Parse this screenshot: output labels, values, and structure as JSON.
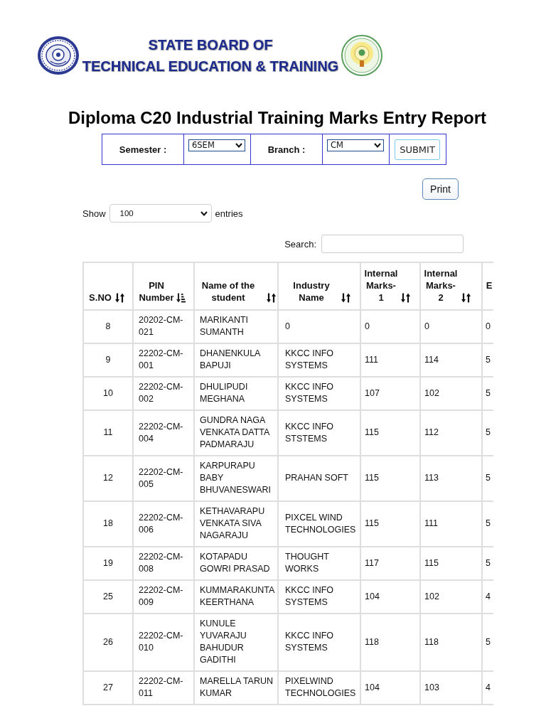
{
  "banner": {
    "line_1": "STATE BOARD OF",
    "line_2": "TECHNICAL EDUCATION & TRAINING"
  },
  "title": "Diploma C20 Industrial Training Marks Entry Report",
  "filter_form": {
    "semester_label": "Semester :",
    "semester": "6SEM",
    "branch_label": "Branch :",
    "branch": "CM",
    "submit": "SUBMIT"
  },
  "print_button": "Print",
  "length_menu": {
    "show": "Show",
    "value": "100",
    "entries": "entries"
  },
  "search": {
    "label": "Search:"
  },
  "table": {
    "columns": [
      {
        "label": "S.NO",
        "sorted": false
      },
      {
        "label": "PIN Number",
        "sorted": true
      },
      {
        "label": "Name of the student",
        "sorted": false
      },
      {
        "label": "Industry Name",
        "sorted": false
      },
      {
        "label": "Internal Marks-1",
        "sorted": false
      },
      {
        "label": "Internal Marks-2",
        "sorted": false
      },
      {
        "label": "E"
      }
    ],
    "rows": [
      [
        "8",
        "20202-CM-021",
        "MARIKANTI SUMANTH",
        "0",
        "0",
        "0",
        "0"
      ],
      [
        "9",
        "22202-CM-001",
        "DHANENKULA BAPUJI",
        "KKCC INFO SYSTEMS",
        "111",
        "114",
        "5"
      ],
      [
        "10",
        "22202-CM-002",
        "DHULIPUDI MEGHANA",
        "KKCC INFO SYSTEMS",
        "107",
        "102",
        "5"
      ],
      [
        "11",
        "22202-CM-004",
        "GUNDRA NAGA VENKATA DATTA PADMARAJU",
        "KKCC INFO STSTEMS",
        "115",
        "112",
        "5"
      ],
      [
        "12",
        "22202-CM-005",
        "KARPURAPU BABY BHUVANESWARI",
        "PRAHAN SOFT",
        "115",
        "113",
        "5"
      ],
      [
        "18",
        "22202-CM-006",
        "KETHAVARAPU VENKATA SIVA NAGARAJU",
        "PIXCEL WIND TECHNOLOGIES",
        "115",
        "111",
        "5"
      ],
      [
        "19",
        "22202-CM-008",
        "KOTAPADU GOWRI PRASAD",
        "THOUGHT WORKS",
        "117",
        "115",
        "5"
      ],
      [
        "25",
        "22202-CM-009",
        "KUMMARAKUNTA KEERTHANA",
        "KKCC INFO SYSTEMS",
        "104",
        "102",
        "4"
      ],
      [
        "26",
        "22202-CM-010",
        "KUNULE YUVARAJU BAHUDUR GADITHI",
        "KKCC INFO SYSTEMS",
        "118",
        "118",
        "5"
      ],
      [
        "27",
        "22202-CM-011",
        "MARELLA TARUN KUMAR",
        "PIXELWIND TECHNOLOGIES",
        "104",
        "103",
        "4"
      ]
    ]
  }
}
